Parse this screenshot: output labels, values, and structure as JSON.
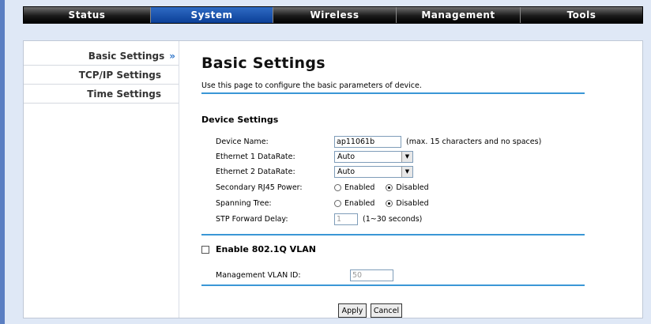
{
  "nav": {
    "tabs": [
      {
        "label": "Status"
      },
      {
        "label": "System"
      },
      {
        "label": "Wireless"
      },
      {
        "label": "Management"
      },
      {
        "label": "Tools"
      }
    ],
    "active": "System"
  },
  "sidebar": {
    "items": [
      {
        "label": "Basic Settings",
        "arrow": "»"
      },
      {
        "label": "TCP/IP Settings"
      },
      {
        "label": "Time Settings"
      }
    ]
  },
  "page": {
    "title": "Basic Settings",
    "description": "Use this page to configure the basic parameters of device."
  },
  "device_settings": {
    "title": "Device Settings",
    "device_name": {
      "label": "Device Name:",
      "value": "ap11061b",
      "hint": "(max. 15 characters and no spaces)"
    },
    "eth1_datarate": {
      "label": "Ethernet 1 DataRate:",
      "value": "Auto"
    },
    "eth2_datarate": {
      "label": "Ethernet 2 DataRate:",
      "value": "Auto"
    },
    "secondary_rj45_power": {
      "label": "Secondary RJ45 Power:",
      "enabled_label": "Enabled",
      "disabled_label": "Disabled",
      "selected": "Disabled"
    },
    "spanning_tree": {
      "label": "Spanning Tree:",
      "enabled_label": "Enabled",
      "disabled_label": "Disabled",
      "selected": "Disabled"
    },
    "stp_forward_delay": {
      "label": "STP Forward Delay:",
      "value": "1",
      "hint": "(1~30 seconds)"
    }
  },
  "vlan": {
    "checkbox_label": "Enable 802.1Q VLAN",
    "checked": false,
    "management_vlan_id": {
      "label": "Management VLAN ID:",
      "value": "50"
    }
  },
  "buttons": {
    "apply": "Apply",
    "cancel": "Cancel"
  },
  "colors": {
    "accent_rule": "#3a97d6",
    "active_tab": "#0b3f97",
    "sidebar_arrow": "#2e74c9"
  }
}
